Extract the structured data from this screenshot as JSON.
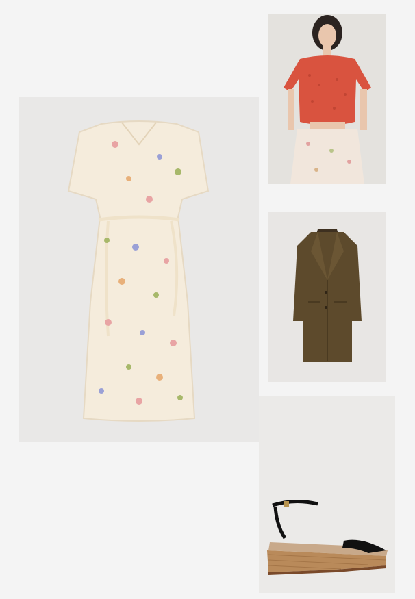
{
  "collage": {
    "background": "#f4f4f4",
    "products": [
      {
        "id": "dress",
        "name": "floral-midi-dress",
        "colors": [
          "#f5ecdc",
          "#e8a4a4",
          "#a7b86a",
          "#9aa0d6"
        ]
      },
      {
        "id": "top",
        "name": "red-crochet-cardigan",
        "colors": [
          "#d9533f",
          "#f1e6dc"
        ]
      },
      {
        "id": "coat",
        "name": "olive-brown-tweed-coat",
        "colors": [
          "#5d4a2c"
        ]
      },
      {
        "id": "sandal",
        "name": "black-espadrille-wedge-sandal",
        "colors": [
          "#111111",
          "#b98a5a"
        ]
      }
    ]
  }
}
